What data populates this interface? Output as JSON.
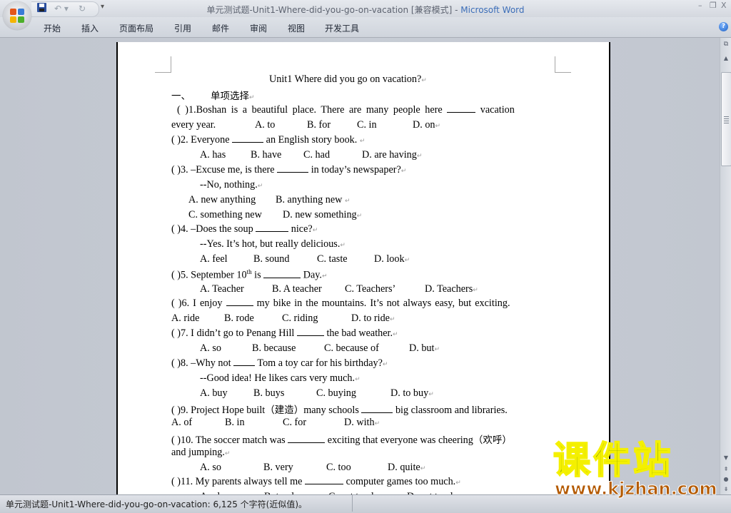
{
  "window": {
    "title_doc": "单元测试题-Unit1-Where-did-you-go-on-vacation [兼容模式]",
    "title_sep": " - ",
    "title_app": "Microsoft Word",
    "minimize": "–",
    "maximize": "❐",
    "close": "X"
  },
  "quick_access": {
    "save_icon": "save-icon",
    "undo": "↶ ▾",
    "redo": "↻",
    "customize": "▾"
  },
  "ribbon": {
    "tabs": [
      "开始",
      "插入",
      "页面布局",
      "引用",
      "邮件",
      "审阅",
      "视图",
      "开发工具"
    ],
    "help": "?"
  },
  "document": {
    "title": "Unit1 Where did you go on vacation?",
    "section": {
      "num": "一、",
      "label": "单项选择"
    },
    "lines": {
      "q1a": "(    )1.Boshan is a beautiful place. There are many people here",
      "q1a_end": "vacation",
      "q1b": "every year.",
      "q1_opts": [
        "A. to",
        "B. for",
        "C. in",
        "D. on"
      ],
      "q2": "(    )2. Everyone",
      "q2_end": "an English story book.",
      "q2_opts": [
        "A. has",
        "B. have",
        "C. had",
        "D. are having"
      ],
      "q3": "(    )3. –Excuse me, is there",
      "q3_end": "in today’s newspaper?",
      "q3_reply": "--No, nothing.",
      "q3_opts_ab": [
        "A. new anything",
        "B. anything new"
      ],
      "q3_opts_cd": [
        "C. something new",
        "D. new something"
      ],
      "q4": "(    )4. –Does the soup",
      "q4_end": "nice?",
      "q4_reply": "--Yes. It’s hot, but really  delicious.",
      "q4_opts": [
        "A. feel",
        "B. sound",
        "C. taste",
        "D. look"
      ],
      "q5": "(    )5. September 10",
      "q5_sup": "th",
      "q5_mid": " is",
      "q5_end": "Day.",
      "q5_opts": [
        "A. Teacher",
        "B. A teacher",
        "C. Teachers’",
        "D. Teachers"
      ],
      "q6": "(    )6. I enjoy",
      "q6_end": "my bike in the mountains. It’s not always easy, but exciting.",
      "q6_opts": [
        "A. ride",
        "B. rode",
        "C. riding",
        "D. to ride"
      ],
      "q7": "(    )7. I didn’t go to Penang Hill",
      "q7_end": "the bad weather.",
      "q7_opts": [
        "A. so",
        "B. because",
        "C. because of",
        "D. but"
      ],
      "q8": "(    )8. –Why not",
      "q8_end": "Tom a toy car for his birthday?",
      "q8_reply": "--Good idea! He likes cars very much.",
      "q8_opts": [
        "A. buy",
        "B. buys",
        "C. buying",
        "D. to buy"
      ],
      "q9": "(    )9. Project Hope built",
      "q9_cn": "（建造）",
      "q9_mid": "many schools",
      "q9_end": "big classroom and libraries.",
      "q9_opts": [
        "A. of",
        "B. in",
        "C. for",
        "D. with"
      ],
      "q10": "(    )10. The soccer match was",
      "q10_end": "exciting that everyone was cheering",
      "q10_cn": "（欢呼）",
      "q10_b": "and jumping.",
      "q10_opts": [
        "A. so",
        "B. very",
        "C. too",
        "D. quite"
      ],
      "q11": "(    )11. My parents always tell me",
      "q11_end": "computer games too much.",
      "q11_opts_partial": [
        "A. play",
        "B. to play",
        "C. not to play",
        "D. not to play"
      ]
    },
    "para_mark": "↵"
  },
  "statusbar": {
    "text": "单元测试题-Unit1-Where-did-you-go-on-vacation: 6,125 个字符(近似值)。"
  },
  "watermark": {
    "cn": "课件站",
    "url": "www.kjzhan.com"
  },
  "colors": {
    "app_title": "#3b6db8",
    "watermark_green": "#4f7a00",
    "watermark_yellow": "#f4f000",
    "watermark_orange": "#b45a00"
  }
}
